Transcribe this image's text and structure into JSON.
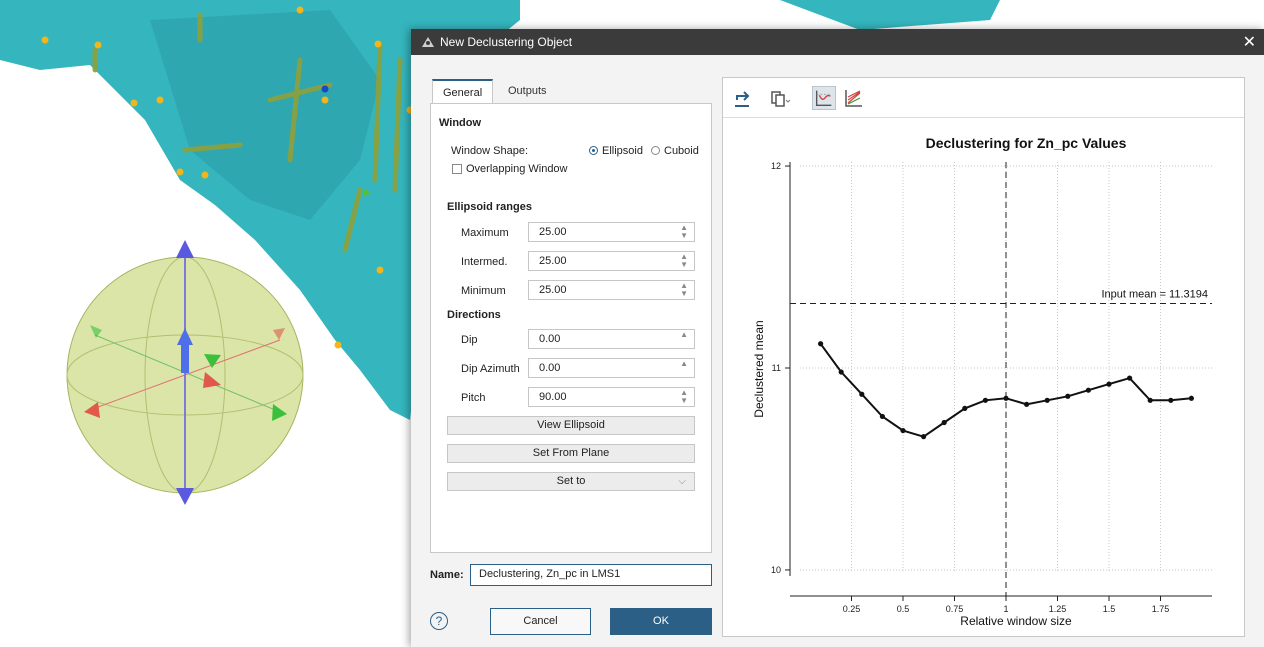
{
  "dialog": {
    "title": "New Declustering Object",
    "tabs": [
      "General",
      "Outputs"
    ],
    "window": {
      "heading": "Window",
      "shape_label": "Window Shape:",
      "shape_options": [
        "Ellipsoid",
        "Cuboid"
      ],
      "shape_selected": "Ellipsoid",
      "overlapping_label": "Overlapping Window",
      "overlapping_checked": false
    },
    "ellipsoid_ranges": {
      "heading": "Ellipsoid ranges",
      "fields": [
        {
          "label": "Maximum",
          "value": "25.00"
        },
        {
          "label": "Intermed.",
          "value": "25.00"
        },
        {
          "label": "Minimum",
          "value": "25.00"
        }
      ]
    },
    "directions": {
      "heading": "Directions",
      "fields": [
        {
          "label": "Dip",
          "value": "0.00"
        },
        {
          "label": "Dip Azimuth",
          "value": "0.00"
        },
        {
          "label": "Pitch",
          "value": "90.00"
        }
      ]
    },
    "buttons": {
      "view_ellipsoid": "View Ellipsoid",
      "set_from_plane": "Set From Plane",
      "set_to": "Set to"
    },
    "name_label": "Name:",
    "name_value": "Declustering, Zn_pc in LMS1",
    "help": "?",
    "cancel": "Cancel",
    "ok": "OK"
  },
  "toolbar_icons": [
    "export-icon",
    "copy-icon",
    "declustering-plot-icon",
    "multi-plot-icon"
  ],
  "colors": {
    "accent": "#2b5f86",
    "titlebar": "#3b3b3b",
    "surface": "#35b5bd"
  },
  "chart_data": {
    "type": "line",
    "title": "Declustering for Zn_pc Values",
    "xlabel": "Relative window size",
    "ylabel": "Declustered mean",
    "xlim": [
      0.0,
      2.0
    ],
    "ylim": [
      9.97,
      12.02
    ],
    "xticks": [
      0.25,
      0.5,
      0.75,
      1,
      1.25,
      1.5,
      1.75
    ],
    "xtick_labels": [
      "0.25",
      "0.5",
      "0.75",
      "1",
      "1.25",
      "1.5",
      "1.75"
    ],
    "yticks": [
      10,
      11,
      12
    ],
    "ytick_labels": [
      "10",
      "11",
      "12"
    ],
    "grid": true,
    "input_mean": 11.3194,
    "input_mean_label": "Input mean = 11.3194",
    "selected_x": 1,
    "x": [
      0.1,
      0.2,
      0.3,
      0.4,
      0.5,
      0.6,
      0.7,
      0.8,
      0.9,
      1.0,
      1.1,
      1.2,
      1.3,
      1.4,
      1.5,
      1.6,
      1.7,
      1.8,
      1.9
    ],
    "y": [
      11.12,
      10.98,
      10.87,
      10.76,
      10.69,
      10.66,
      10.73,
      10.8,
      10.84,
      10.85,
      10.82,
      10.84,
      10.86,
      10.89,
      10.92,
      10.95,
      10.84,
      10.84,
      10.85
    ]
  }
}
